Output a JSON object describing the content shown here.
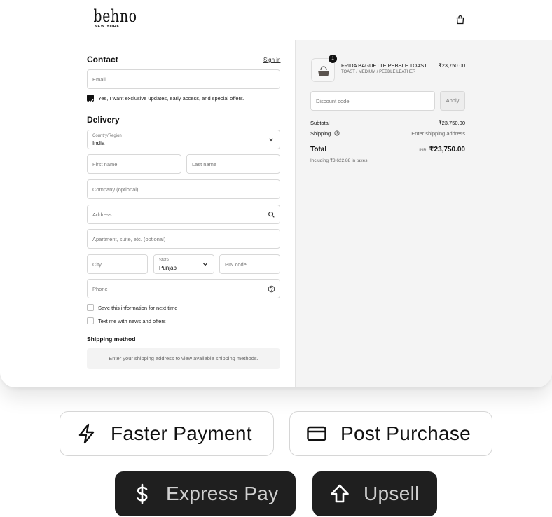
{
  "header": {
    "logo_main": "behno",
    "logo_sub": "NEW YORK",
    "bag_icon": "shopping-bag-icon"
  },
  "contact": {
    "title": "Contact",
    "sign_in": "Sign in",
    "email_placeholder": "Email",
    "newsletter_label": "Yes, I want exclusive updates, early access, and special offers.",
    "newsletter_checked": true
  },
  "delivery": {
    "title": "Delivery",
    "country_label": "Country/Region",
    "country_value": "India",
    "first_name_placeholder": "First name",
    "last_name_placeholder": "Last name",
    "company_placeholder": "Company (optional)",
    "address_placeholder": "Address",
    "apartment_placeholder": "Apartment, suite, etc. (optional)",
    "city_placeholder": "City",
    "state_label": "State",
    "state_value": "Punjab",
    "pin_placeholder": "PIN code",
    "phone_placeholder": "Phone",
    "save_info_label": "Save this information for next time",
    "save_info_checked": false,
    "text_me_label": "Text me with news and offers",
    "text_me_checked": false
  },
  "shipping": {
    "title": "Shipping method",
    "note": "Enter your shipping address to view available shipping methods."
  },
  "summary": {
    "qty": "1",
    "product_name": "FRIDA BAGUETTE PEBBLE TOAST",
    "product_variant": "TOAST / MEDIUM / PEBBLE LEATHER",
    "product_price": "₹23,750.00",
    "discount_placeholder": "Discount code",
    "apply_label": "Apply",
    "subtotal_label": "Subtotal",
    "subtotal_value": "₹23,750.00",
    "shipping_label": "Shipping",
    "shipping_value": "Enter shipping address",
    "total_label": "Total",
    "total_currency": "INR",
    "total_value": "₹23,750.00",
    "taxes_note": "Including ₹3,622.88 in taxes"
  },
  "badges": {
    "faster_payment": "Faster Payment",
    "post_purchase": "Post Purchase",
    "express_pay": "Express Pay",
    "upsell": "Upsell"
  },
  "colors": {
    "dark_pill": "#1f1f1f",
    "summary_bg": "#f4f4f4",
    "border": "#d8d8d8"
  }
}
